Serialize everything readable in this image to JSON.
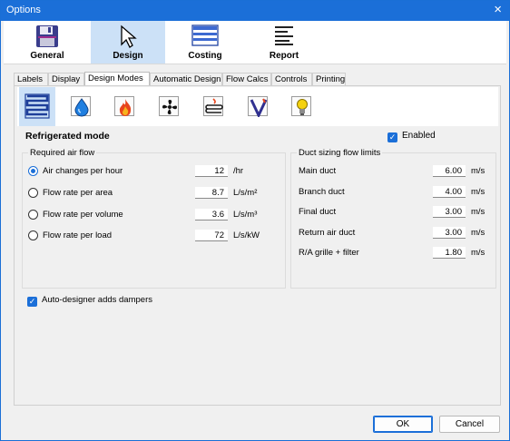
{
  "window": {
    "title": "Options",
    "close": "×"
  },
  "bigtabs": [
    {
      "label": "General",
      "icon": "floppy-disk-icon"
    },
    {
      "label": "Design",
      "icon": "cursor-arrow-icon"
    },
    {
      "label": "Costing",
      "icon": "table-icon"
    },
    {
      "label": "Report",
      "icon": "report-lines-icon"
    }
  ],
  "tabs": [
    "Labels",
    "Display",
    "Design Modes",
    "Automatic Design",
    "Flow Calcs",
    "Controls",
    "Printing"
  ],
  "mode_icons": [
    "refrigerated-coil-icon",
    "water-drop-icon",
    "flame-icon",
    "fan-icon",
    "heating-element-icon",
    "v-letter-icon",
    "light-bulb-icon"
  ],
  "section": {
    "title": "Refrigerated mode",
    "enabled_label": "Enabled"
  },
  "required_air_flow": {
    "title": "Required air flow",
    "rows": [
      {
        "label": "Air changes per hour",
        "value": "12",
        "unit": "/hr"
      },
      {
        "label": "Flow rate per area",
        "value": "8.7",
        "unit": "L/s/m²"
      },
      {
        "label": "Flow rate per volume",
        "value": "3.6",
        "unit": "L/s/m³"
      },
      {
        "label": "Flow rate per load",
        "value": "72",
        "unit": "L/s/kW"
      }
    ]
  },
  "duct_limits": {
    "title": "Duct sizing flow limits",
    "rows": [
      {
        "label": "Main duct",
        "value": "6.00",
        "unit": "m/s"
      },
      {
        "label": "Branch duct",
        "value": "4.00",
        "unit": "m/s"
      },
      {
        "label": "Final duct",
        "value": "3.00",
        "unit": "m/s"
      },
      {
        "label": "Return air duct",
        "value": "3.00",
        "unit": "m/s"
      },
      {
        "label": "R/A grille + filter",
        "value": "1.80",
        "unit": "m/s"
      }
    ]
  },
  "dampers_label": "Auto-designer adds dampers",
  "buttons": {
    "ok": "OK",
    "cancel": "Cancel"
  },
  "colors": {
    "accent": "#1b6fd8",
    "selected": "#cce1f7"
  }
}
